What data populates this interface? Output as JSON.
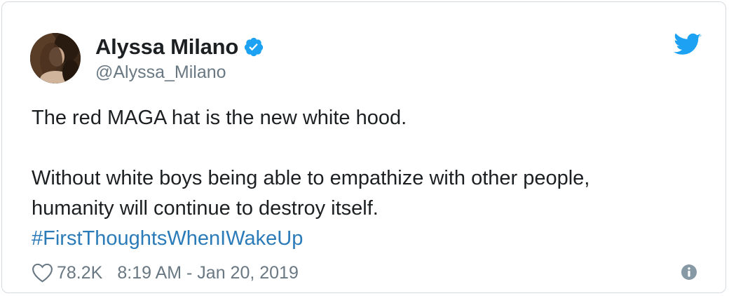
{
  "author": {
    "name": "Alyssa Milano",
    "handle": "@Alyssa_Milano",
    "verified": true
  },
  "tweet": {
    "line1": "The red MAGA hat is the new white hood.",
    "line2": "Without white boys being able to empathize with other people,",
    "line3": "humanity will continue to destroy itself.",
    "hashtag": "#FirstThoughtsWhenIWakeUp"
  },
  "footer": {
    "likes": "78.2K",
    "timestamp": "8:19 AM - Jan 20, 2019"
  },
  "icons": {
    "brand": "twitter-bird-icon",
    "verified": "verified-badge-icon",
    "like": "heart-icon",
    "info": "info-icon"
  },
  "colors": {
    "twitter_blue": "#1da1f2",
    "link_blue": "#2b7bb9",
    "secondary_text": "#697882",
    "primary_text": "#1c2022"
  }
}
